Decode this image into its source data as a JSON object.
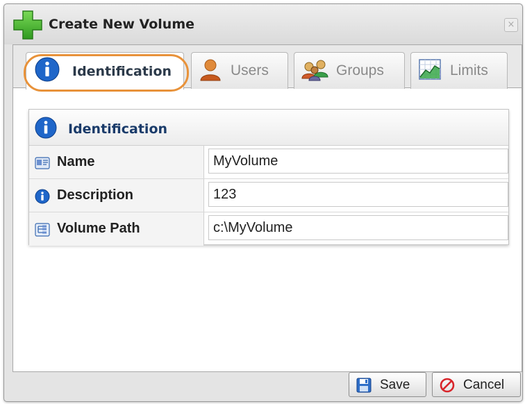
{
  "dialog": {
    "title": "Create New Volume",
    "title_icon": "green-plus-icon",
    "close_glyph": "×"
  },
  "tabs": [
    {
      "label": "Identification",
      "icon": "info-icon",
      "active": true
    },
    {
      "label": "Users",
      "icon": "user-icon",
      "active": false
    },
    {
      "label": "Groups",
      "icon": "group-icon",
      "active": false
    },
    {
      "label": "Limits",
      "icon": "chart-icon",
      "active": false
    }
  ],
  "section": {
    "title": "Identification",
    "icon": "info-icon"
  },
  "fields": [
    {
      "label": "Name",
      "value": "MyVolume",
      "icon": "id-card-icon"
    },
    {
      "label": "Description",
      "value": "123",
      "icon": "info-icon"
    },
    {
      "label": "Volume Path",
      "value": "c:\\MyVolume",
      "icon": "folder-path-icon"
    }
  ],
  "buttons": {
    "save_label": "Save",
    "cancel_label": "Cancel"
  },
  "colors": {
    "highlight": "#e8923a",
    "section_title": "#1a3b6a",
    "plus_green": "#3fae2a",
    "info_blue": "#1f66c9"
  }
}
